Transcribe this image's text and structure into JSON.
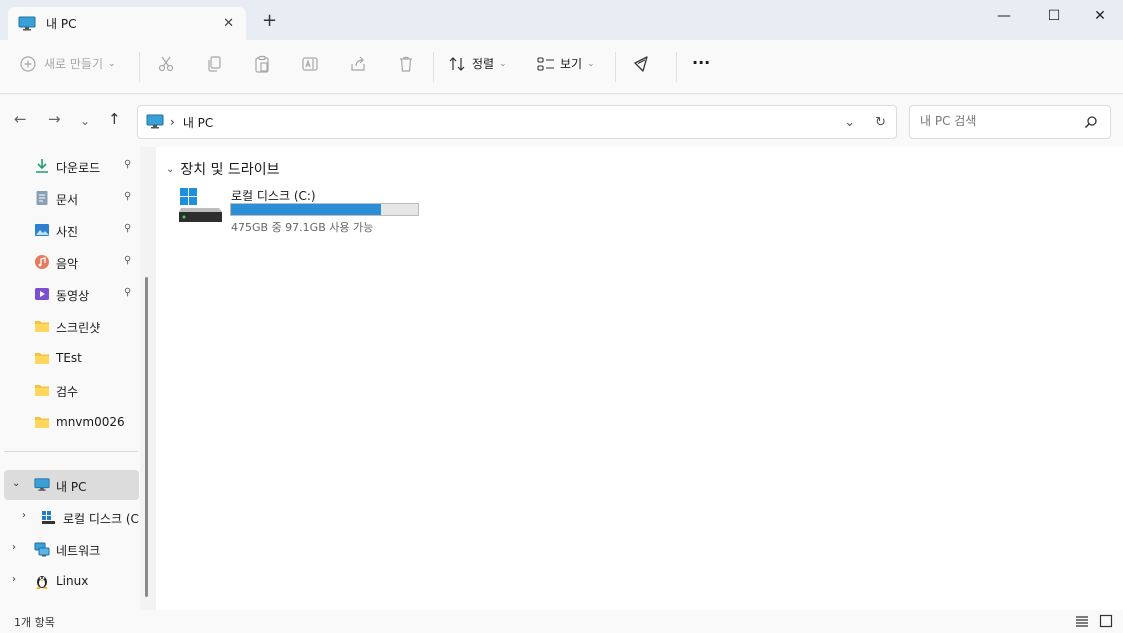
{
  "window": {
    "tab_title": "내 PC",
    "new_tab_label": "+",
    "close_tab_label": "✕",
    "minimize_label": "—",
    "maximize_label": "☐",
    "close_label": "✕"
  },
  "toolbar": {
    "new_label": "새로 만들기",
    "sort_label": "정렬",
    "view_label": "보기",
    "more_label": "···"
  },
  "address": {
    "path": "내 PC",
    "refresh_icon": "↻",
    "dropdown_icon": "⌄"
  },
  "search": {
    "placeholder": "내 PC 검색"
  },
  "sidebar": {
    "quick_access": [
      {
        "label": "다운로드",
        "icon": "download-icon",
        "pinned": true
      },
      {
        "label": "문서",
        "icon": "document-icon",
        "pinned": true
      },
      {
        "label": "사진",
        "icon": "picture-icon",
        "pinned": true
      },
      {
        "label": "음악",
        "icon": "music-icon",
        "pinned": true
      },
      {
        "label": "동영상",
        "icon": "video-icon",
        "pinned": true
      },
      {
        "label": "스크린샷",
        "icon": "folder-icon",
        "pinned": false
      },
      {
        "label": "TEst",
        "icon": "folder-icon",
        "pinned": false
      },
      {
        "label": "검수",
        "icon": "folder-icon",
        "pinned": false
      },
      {
        "label": "mnvm0026",
        "icon": "folder-icon",
        "pinned": false
      }
    ],
    "this_pc": "내 PC",
    "local_disk": "로컬 디스크 (C",
    "network": "네트워크",
    "linux": "Linux"
  },
  "content": {
    "group_header": "장치 및 드라이브",
    "drive": {
      "label": "로컬 디스크 (C:)",
      "info": "475GB 중 97.1GB 사용 가능",
      "used_fraction": 0.8
    }
  },
  "status": {
    "count": "1개 항목"
  },
  "colors": {
    "accent": "#2c8fd6",
    "folder": "#f4c342",
    "selection": "#dcdcdc"
  }
}
